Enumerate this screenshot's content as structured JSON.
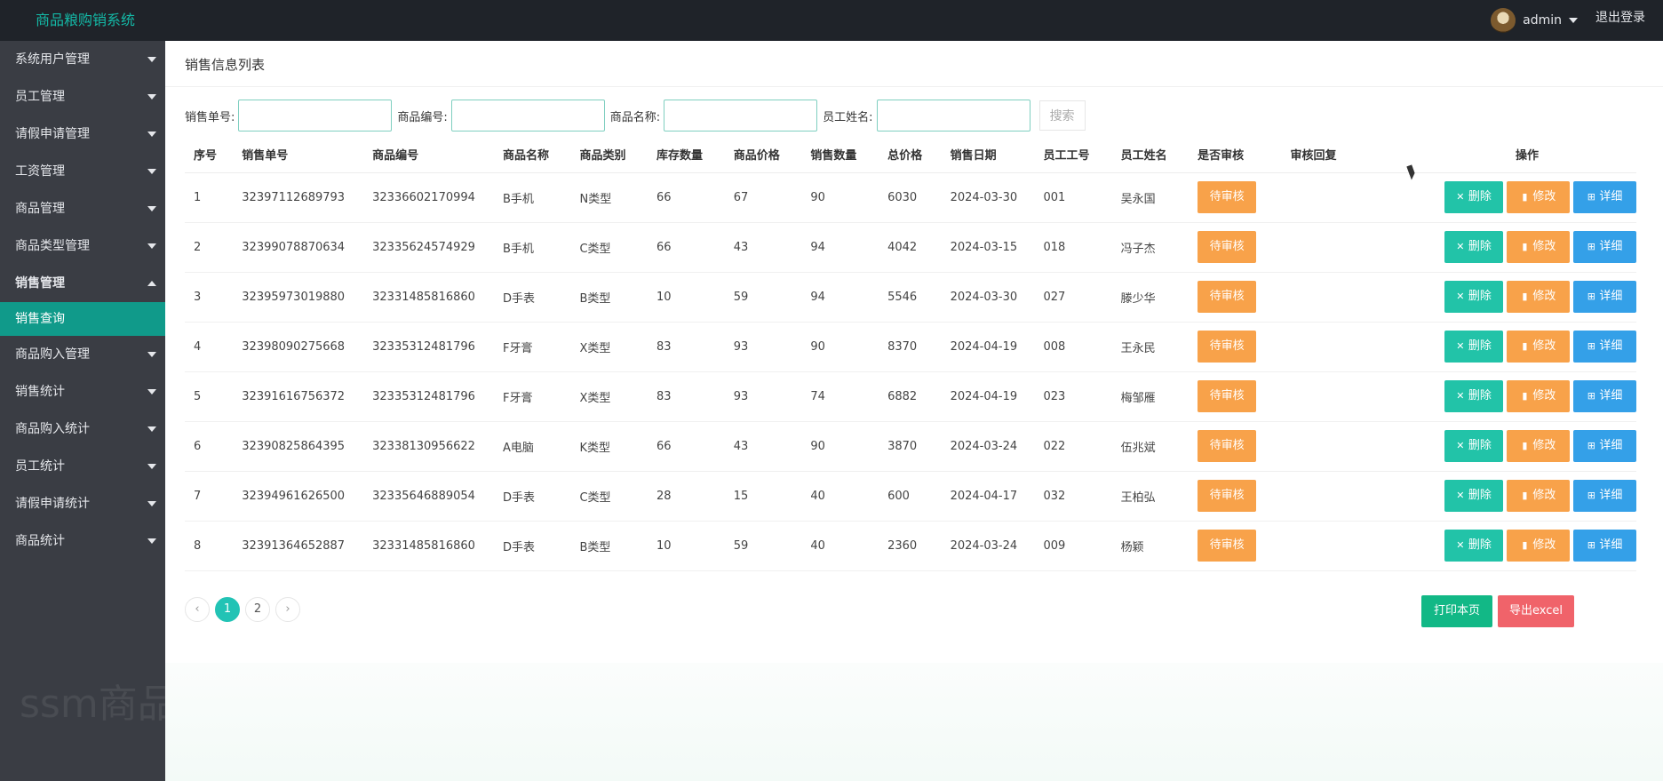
{
  "app": {
    "title": "商品粮购销系统"
  },
  "header": {
    "user_name": "admin",
    "logout_label": "退出登录"
  },
  "sidebar": {
    "items": [
      {
        "label": "系统用户管理"
      },
      {
        "label": "员工管理"
      },
      {
        "label": "请假申请管理"
      },
      {
        "label": "工资管理"
      },
      {
        "label": "商品管理"
      },
      {
        "label": "商品类型管理"
      },
      {
        "label": "销售管理"
      },
      {
        "label": "销售查询"
      },
      {
        "label": "商品购入管理"
      },
      {
        "label": "销售统计"
      },
      {
        "label": "商品购入统计"
      },
      {
        "label": "员工统计"
      },
      {
        "label": "请假申请统计"
      },
      {
        "label": "商品统计"
      }
    ],
    "watermark": "ssm商品"
  },
  "main": {
    "title": "销售信息列表",
    "search": {
      "order_no_label": "销售单号:",
      "goods_no_label": "商品编号:",
      "goods_name_label": "商品名称:",
      "staff_name_label": "员工姓名:",
      "search_label": "搜索"
    },
    "table": {
      "headers": [
        "序号",
        "销售单号",
        "商品编号",
        "商品名称",
        "商品类别",
        "库存数量",
        "商品价格",
        "销售数量",
        "总价格",
        "销售日期",
        "员工工号",
        "员工姓名",
        "是否审核",
        "审核回复",
        "操作"
      ],
      "rows": [
        [
          "1",
          "32397112689793",
          "32336602170994",
          "B手机",
          "N类型",
          "66",
          "67",
          "90",
          "6030",
          "2024-03-30",
          "001",
          "吴永国",
          "待审核",
          ""
        ],
        [
          "2",
          "32399078870634",
          "32335624574929",
          "B手机",
          "C类型",
          "66",
          "43",
          "94",
          "4042",
          "2024-03-15",
          "018",
          "冯子杰",
          "待审核",
          ""
        ],
        [
          "3",
          "32395973019880",
          "32331485816860",
          "D手表",
          "B类型",
          "10",
          "59",
          "94",
          "5546",
          "2024-03-30",
          "027",
          "滕少华",
          "待审核",
          ""
        ],
        [
          "4",
          "32398090275668",
          "32335312481796",
          "F牙膏",
          "X类型",
          "83",
          "93",
          "90",
          "8370",
          "2024-04-19",
          "008",
          "王永民",
          "待审核",
          ""
        ],
        [
          "5",
          "32391616756372",
          "32335312481796",
          "F牙膏",
          "X类型",
          "83",
          "93",
          "74",
          "6882",
          "2024-04-19",
          "023",
          "梅邹雁",
          "待审核",
          ""
        ],
        [
          "6",
          "32390825864395",
          "32338130956622",
          "A电脑",
          "K类型",
          "66",
          "43",
          "90",
          "3870",
          "2024-03-24",
          "022",
          "伍兆斌",
          "待审核",
          ""
        ],
        [
          "7",
          "32394961626500",
          "32335646889054",
          "D手表",
          "C类型",
          "28",
          "15",
          "40",
          "600",
          "2024-04-17",
          "032",
          "王柏弘",
          "待审核",
          ""
        ],
        [
          "8",
          "32391364652887",
          "32331485816860",
          "D手表",
          "B类型",
          "10",
          "59",
          "40",
          "2360",
          "2024-03-24",
          "009",
          "杨颖",
          "待审核",
          ""
        ]
      ],
      "op_delete": "删除",
      "op_edit": "修改",
      "op_detail": "详细"
    },
    "pager": {
      "prev": "‹",
      "pages": [
        "1",
        "2"
      ],
      "next": "›"
    },
    "print_label": "打印本页",
    "export_label": "导出excel"
  }
}
